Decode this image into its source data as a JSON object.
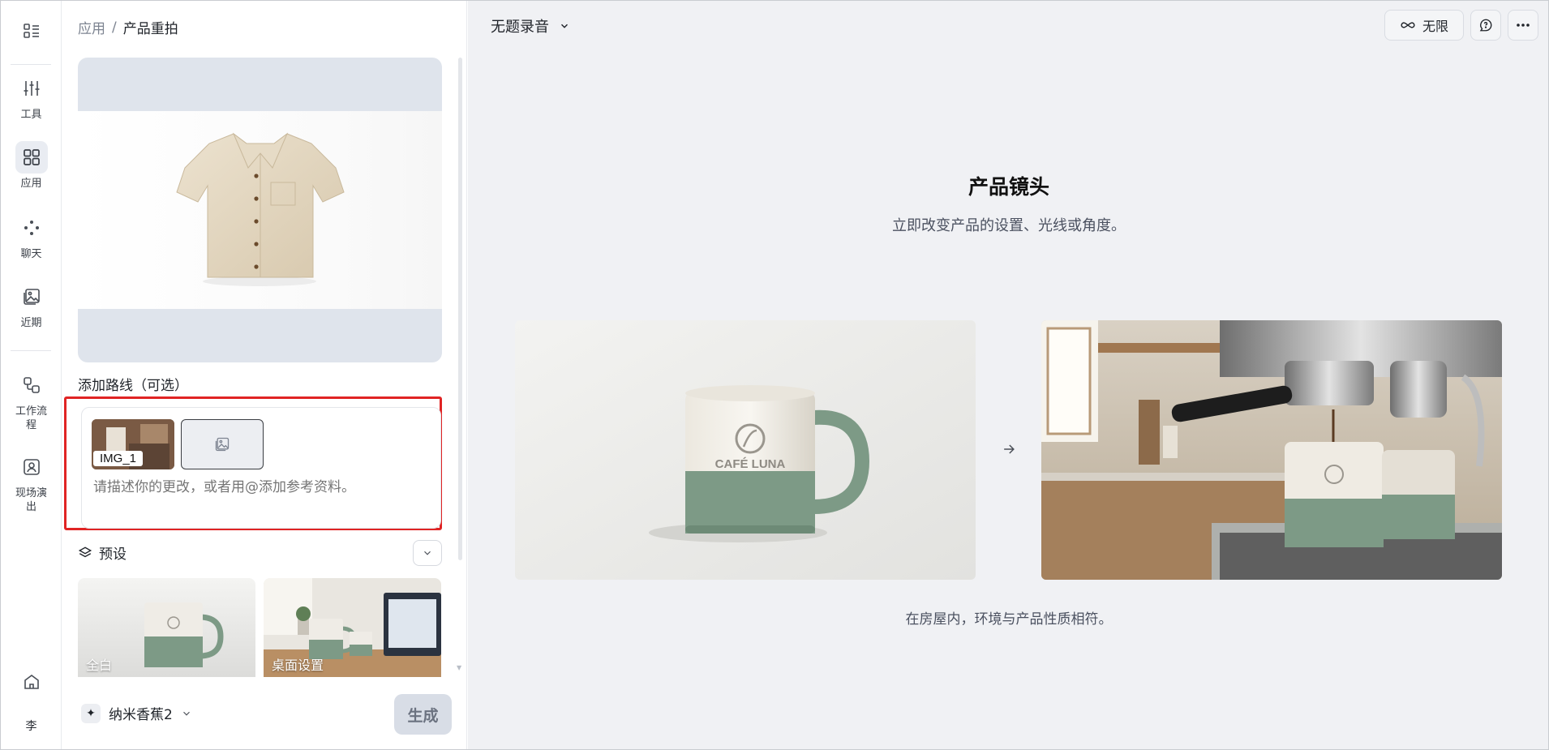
{
  "rail": {
    "items": [
      {
        "label": "",
        "icon": "menu-list-icon"
      },
      {
        "label": "工具",
        "icon": "sliders-icon"
      },
      {
        "label": "应用",
        "icon": "apps-grid-icon"
      },
      {
        "label": "聊天",
        "icon": "dots-icon"
      },
      {
        "label": "近期",
        "icon": "recent-images-icon"
      },
      {
        "label": "工作流程",
        "icon": "workflow-icon"
      },
      {
        "label": "现场演出",
        "icon": "live-user-icon"
      }
    ],
    "home_icon": "home-icon",
    "avatar_initial": "李"
  },
  "panel": {
    "breadcrumb": {
      "parent": "应用",
      "separator": "/",
      "current": "产品重拍"
    },
    "route_label": "添加路线（可选）",
    "attachment_label": "IMG_1",
    "prompt_placeholder": "请描述你的更改，或者用@添加参考资料。",
    "presets_label": "预设",
    "presets": [
      {
        "label": "全白"
      },
      {
        "label": "桌面设置"
      }
    ],
    "model_icon": "✦",
    "model_name": "纳米香蕉2",
    "generate_label": "生成"
  },
  "main": {
    "recording_title": "无题录音",
    "limit_label": "无限",
    "hero_title": "产品镜头",
    "hero_subtitle": "立即改变产品的设置、光线或角度。",
    "demo_caption": "在房屋内，环境与产品性质相符。",
    "mug_brand": "CAFÉ LUNA"
  },
  "colors": {
    "accent_border": "#e02424",
    "main_bg": "#f0f1f4",
    "mug_green": "#7d9a86"
  }
}
